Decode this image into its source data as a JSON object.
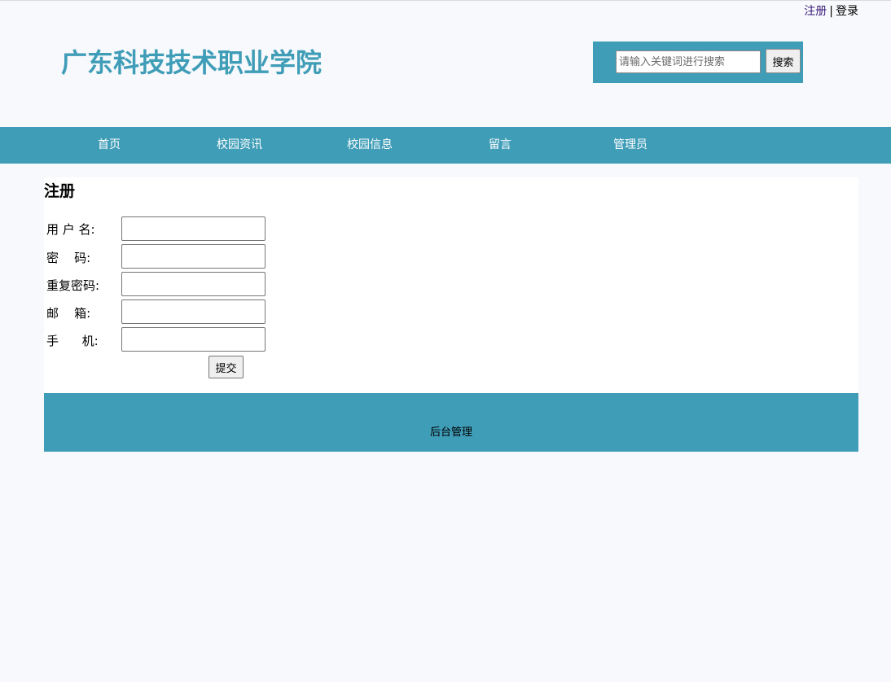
{
  "toplinks": {
    "register": "注册",
    "separator": "|",
    "login": "登录"
  },
  "header": {
    "site_title": "广东科技技术职业学院",
    "search_placeholder": "请输入关键词进行搜索",
    "search_button": "搜索"
  },
  "nav": {
    "items": [
      "首页",
      "校园资讯",
      "校园信息",
      "留言",
      "管理员"
    ]
  },
  "form": {
    "title": "注册",
    "fields": [
      {
        "label": "用 户 名:",
        "value": ""
      },
      {
        "label": "密    码:",
        "value": ""
      },
      {
        "label": "重复密码:",
        "value": ""
      },
      {
        "label": "邮    箱:",
        "value": ""
      },
      {
        "label": "手      机:",
        "value": ""
      }
    ],
    "submit": "提交"
  },
  "footer": {
    "admin_link": "后台管理"
  },
  "colors": {
    "accent": "#3f9db7",
    "page_bg": "#f7f9fc"
  }
}
